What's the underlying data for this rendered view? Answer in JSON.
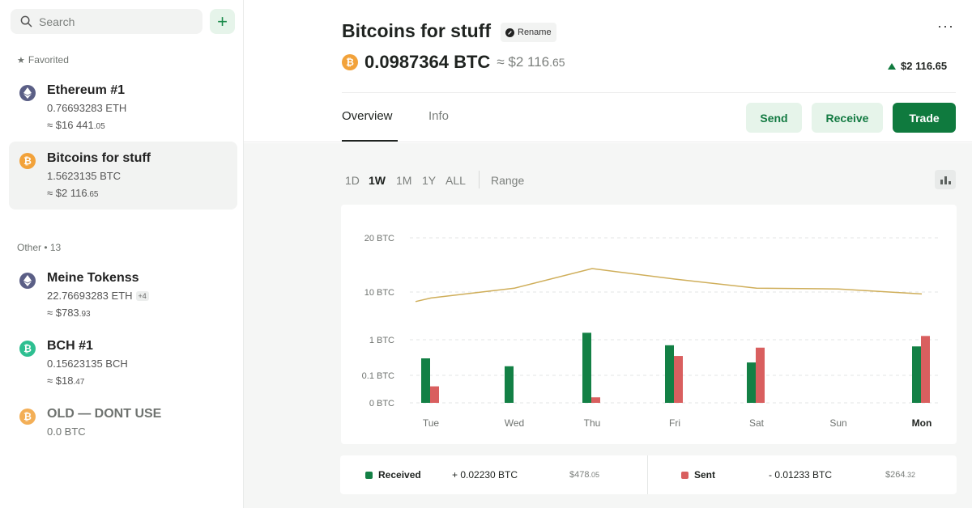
{
  "sidebar": {
    "search_placeholder": "Search",
    "add_label": "+",
    "favorited_label": "Favorited",
    "other_label": "Other • 13",
    "favorites": [
      {
        "name": "Ethereum #1",
        "amount": "0.76693283 ETH",
        "fiat_main": "≈ $16 441",
        "fiat_cents": ".05",
        "icon": "ethereum-icon",
        "icon_color": "#5b5f86"
      }
    ],
    "active": {
      "name": "Bitcoins for stuff",
      "amount": "1.5623135 BTC",
      "fiat_main": "≈ $2 116",
      "fiat_cents": ".65",
      "icon": "bitcoin-icon",
      "icon_color": "#f2a23a"
    },
    "others": [
      {
        "name": "Meine Tokenss",
        "amount": "22.76693283 ETH",
        "extra": "+4",
        "fiat_main": "≈ $783",
        "fiat_cents": ".93",
        "icon": "ethereum-icon",
        "icon_color": "#5b5f86"
      },
      {
        "name": "BCH #1",
        "amount": "0.15623135 BCH",
        "fiat_main": "≈ $18",
        "fiat_cents": ".47",
        "icon": "bitcoin-cash-icon",
        "icon_color": "#2ebf91"
      },
      {
        "name": "OLD — DONT USE",
        "amount": "0.0 BTC",
        "icon": "bitcoin-icon",
        "icon_color": "#f2a23a"
      }
    ]
  },
  "header": {
    "title": "Bitcoins for stuff",
    "rename_label": "Rename",
    "more_label": "···",
    "balance_btc": "0.0987364 BTC",
    "balance_fiat_main": "≈ $2 116",
    "balance_fiat_cents": ".65",
    "change": "$2 116.65",
    "tabs": [
      "Overview",
      "Info"
    ],
    "send_label": "Send",
    "receive_label": "Receive",
    "trade_label": "Trade"
  },
  "ranges": [
    "1D",
    "1W",
    "1M",
    "1Y",
    "ALL",
    "Range"
  ],
  "active_range": "1W",
  "colors": {
    "accent": "#0f7a3e",
    "received": "#138045",
    "sent": "#d95f5f",
    "line": "#cfae5a"
  },
  "chart_data": {
    "type": "bar",
    "categories": [
      "Tue",
      "Wed",
      "Thu",
      "Fri",
      "Sat",
      "Sun",
      "Mon"
    ],
    "y_ticks": [
      "0 BTC",
      "0.1 BTC",
      "1 BTC",
      "10 BTC",
      "20 BTC"
    ],
    "ylim": [
      0,
      20
    ],
    "scale": "log",
    "series": [
      {
        "name": "Received",
        "values": [
          0.3,
          0.18,
          1.4,
          0.7,
          0.23,
          0,
          0.65
        ]
      },
      {
        "name": "Sent",
        "values": [
          0.06,
          0,
          0.02,
          0.35,
          0.6,
          0,
          1.2
        ]
      }
    ],
    "line_series": {
      "values": [
        7.5,
        10.5,
        13.5,
        11.8,
        10.5,
        10.4,
        9.1
      ],
      "start": 6.3
    },
    "grid": true
  },
  "summary": {
    "received_label": "Received",
    "received_btc": "+ 0.02230 BTC",
    "received_fiat_main": "$478",
    "received_fiat_cents": ".05",
    "sent_label": "Sent",
    "sent_btc": "- 0.01233 BTC",
    "sent_fiat_main": "$264",
    "sent_fiat_cents": ".32"
  }
}
